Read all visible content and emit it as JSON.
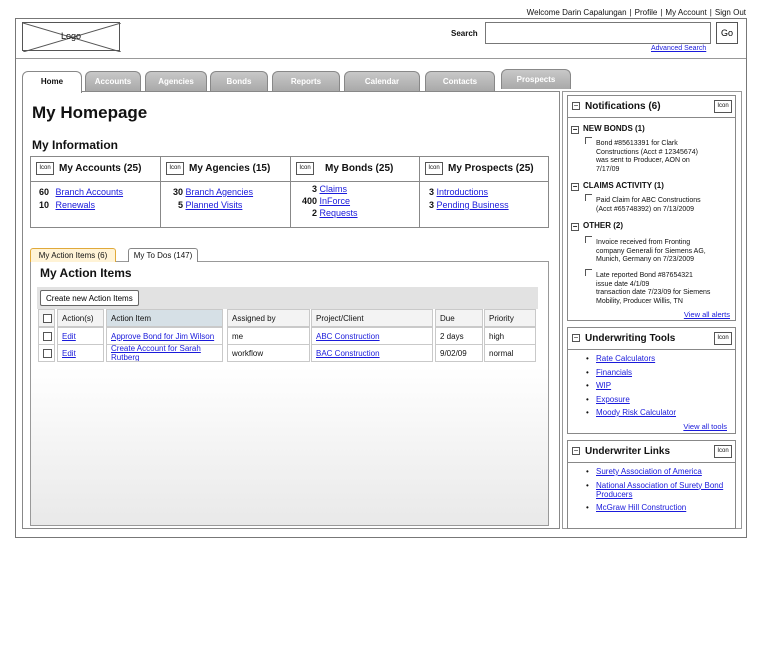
{
  "header": {
    "welcome": "Welcome Darin Capalungan",
    "links": [
      "Profile",
      "My Account",
      "Sign Out"
    ],
    "logo_label": "Logo",
    "search_label": "Search",
    "search_value": "",
    "go_label": "Go",
    "advanced_search": "Advanced Search"
  },
  "tabs": [
    "Home",
    "Accounts",
    "Agencies",
    "Bonds",
    "Reports",
    "Calendar",
    "Contacts",
    "Prospects"
  ],
  "page_title": "My Homepage",
  "my_information": {
    "title": "My Information",
    "icon_label": "Icon",
    "columns": [
      {
        "title": "My Accounts (25)",
        "rows": [
          {
            "count": "60",
            "label": "Branch Accounts"
          },
          {
            "count": "10",
            "label": "Renewals"
          }
        ]
      },
      {
        "title": "My Agencies (15)",
        "rows": [
          {
            "count": "30",
            "label": "Branch Agencies"
          },
          {
            "count": "5",
            "label": "Planned Visits"
          }
        ]
      },
      {
        "title": "My Bonds (25)",
        "rows": [
          {
            "count": "3",
            "label": "Claims"
          },
          {
            "count": "400",
            "label": "InForce"
          },
          {
            "count": "2",
            "label": "Requests"
          }
        ]
      },
      {
        "title": "My Prospects (25)",
        "rows": [
          {
            "count": "3",
            "label": "Introductions"
          },
          {
            "count": "3",
            "label": "Pending Business"
          }
        ]
      }
    ]
  },
  "sub_tabs": [
    "My Action Items (6)",
    "My To Dos (147)"
  ],
  "action_items": {
    "title": "My Action Items",
    "create_button": "Create new Action Items",
    "columns": [
      "Action(s)",
      "Action Item",
      "Assigned by",
      "Project/Client",
      "Due",
      "Priority"
    ],
    "rows": [
      {
        "action": "Edit",
        "item": "Approve Bond for Jim Wilson",
        "assigned_by": "me",
        "project": "ABC Construction",
        "due": "2 days",
        "priority": "high"
      },
      {
        "action": "Edit",
        "item_line1": "Create Account for Sarah",
        "item_line2": "Rutberg",
        "assigned_by": "workflow",
        "project": "BAC Construction",
        "due": "9/02/09",
        "priority": "normal"
      }
    ]
  },
  "notifications": {
    "title": "Notifications (6)",
    "icon_label": "Icon",
    "sections": [
      {
        "title": "NEW BONDS (1)",
        "items": [
          [
            "Bond #85613391 for Clark",
            "Constructions (Acct # 12345674)",
            "was sent to Producer, AON on",
            "7/17/09"
          ]
        ]
      },
      {
        "title": "CLAIMS ACTIVITY (1)",
        "items": [
          [
            "Paid Claim for ABC Constructions",
            "(Acct #65748392) on 7/13/2009"
          ]
        ]
      },
      {
        "title": "OTHER (2)",
        "items": [
          [
            "Invoice received from Fronting",
            "company Generali for Siemens AG,",
            "Munich, Germany on 7/23/2009"
          ],
          [
            "Late reported Bond #87654321",
            "issue date 4/1/09",
            "transaction date 7/23/09 for Siemens",
            "Mobility, Producer Willis, TN"
          ]
        ]
      }
    ],
    "view_all": "View all alerts"
  },
  "underwriting_tools": {
    "title": "Underwriting Tools",
    "icon_label": "Icon",
    "items": [
      "Rate Calculators",
      "Financials",
      "WIP",
      "Exposure",
      "Moody Risk Calculator"
    ],
    "view_all": "View all tools"
  },
  "underwriter_links": {
    "title": "Underwriter Links",
    "icon_label": "Icon",
    "items": [
      {
        "line1": "Surety Association of America"
      },
      {
        "line1": "National Association of Surety Bond",
        "line2": "Producers"
      },
      {
        "line1": "McGraw Hill Construction"
      }
    ]
  }
}
